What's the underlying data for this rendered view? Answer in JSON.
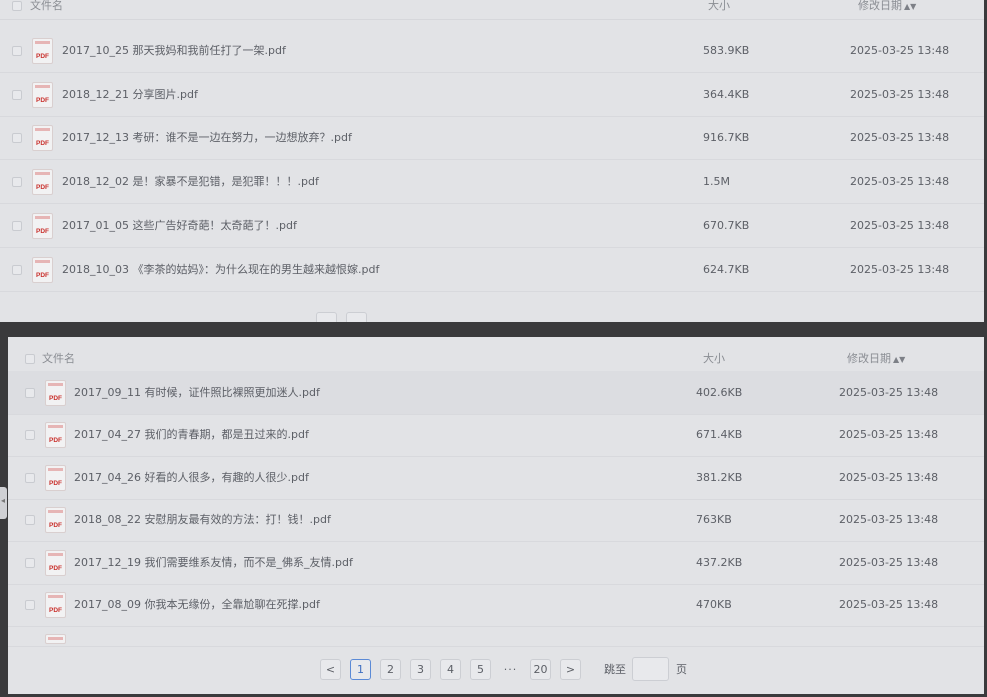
{
  "table": {
    "col_name": "文件名",
    "col_size": "大小",
    "col_date": "修改日期",
    "sort_icon": "sort-icon"
  },
  "file_icon_label": "PDF",
  "top_panel": {
    "rows": [
      {
        "name": "2017_10_25 那天我妈和我前任打了一架.pdf",
        "size": "583.9KB",
        "date": "2025-03-25 13:48"
      },
      {
        "name": "2018_12_21 分享图片.pdf",
        "size": "364.4KB",
        "date": "2025-03-25 13:48"
      },
      {
        "name": "2017_12_13 考研：谁不是一边在努力，一边想放弃？.pdf",
        "size": "916.7KB",
        "date": "2025-03-25 13:48"
      },
      {
        "name": "2018_12_02 是！家暴不是犯错，是犯罪！！！.pdf",
        "size": "1.5M",
        "date": "2025-03-25 13:48"
      },
      {
        "name": "2017_01_05 这些广告好奇葩！太奇葩了！.pdf",
        "size": "670.7KB",
        "date": "2025-03-25 13:48"
      },
      {
        "name": "2018_10_03 《李茶的姑妈》：为什么现在的男生越来越恨嫁.pdf",
        "size": "624.7KB",
        "date": "2025-03-25 13:48"
      }
    ]
  },
  "bottom_panel": {
    "rows": [
      {
        "name": "2017_09_11 有时候，证件照比裸照更加迷人.pdf",
        "size": "402.6KB",
        "date": "2025-03-25 13:48"
      },
      {
        "name": "2017_04_27 我们的青春期，都是丑过来的.pdf",
        "size": "671.4KB",
        "date": "2025-03-25 13:48"
      },
      {
        "name": "2017_04_26 好看的人很多，有趣的人很少.pdf",
        "size": "381.2KB",
        "date": "2025-03-25 13:48"
      },
      {
        "name": "2018_08_22 安慰朋友最有效的方法：打！钱！.pdf",
        "size": "763KB",
        "date": "2025-03-25 13:48"
      },
      {
        "name": "2017_12_19 我们需要维系友情，而不是_佛系_友情.pdf",
        "size": "437.2KB",
        "date": "2025-03-25 13:48"
      },
      {
        "name": "2017_08_09 你我本无缘份，全靠尬聊在死撑.pdf",
        "size": "470KB",
        "date": "2025-03-25 13:48"
      }
    ],
    "pagination": {
      "prev": "<",
      "pages": [
        "1",
        "2",
        "3",
        "4",
        "5"
      ],
      "ellipsis": "···",
      "last": "20",
      "next": ">",
      "jump_label": "跳至",
      "jump_value": "",
      "jump_unit": "页"
    }
  }
}
